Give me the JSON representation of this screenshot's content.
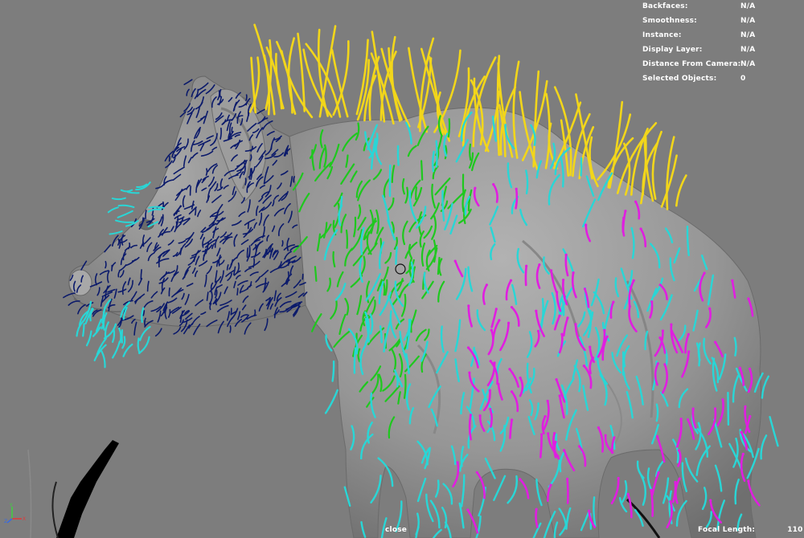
{
  "hud": {
    "stats": [
      {
        "label": "Backfaces:",
        "value": "N/A"
      },
      {
        "label": "Smoothness:",
        "value": "N/A"
      },
      {
        "label": "Instance:",
        "value": "N/A"
      },
      {
        "label": "Display Layer:",
        "value": "N/A"
      },
      {
        "label": "Distance From Camera:",
        "value": "N/A"
      },
      {
        "label": "Selected Objects:",
        "value": "0"
      }
    ],
    "camera": "close",
    "focal_length_label": "Focal Length:",
    "focal_length_value": "110"
  },
  "colors": {
    "viewport_bg": "#7d7d7d",
    "mesh": "#9a9a9a",
    "guide_navy": "#0b1a6b",
    "guide_green": "#1ec81e",
    "guide_cyan": "#29d6d6",
    "guide_magenta": "#e01ee0",
    "guide_yellow": "#f2d61a"
  },
  "icons": {
    "axis_gizmo": "axis-gizmo-icon",
    "manipulator": "manipulator-circle-icon"
  }
}
